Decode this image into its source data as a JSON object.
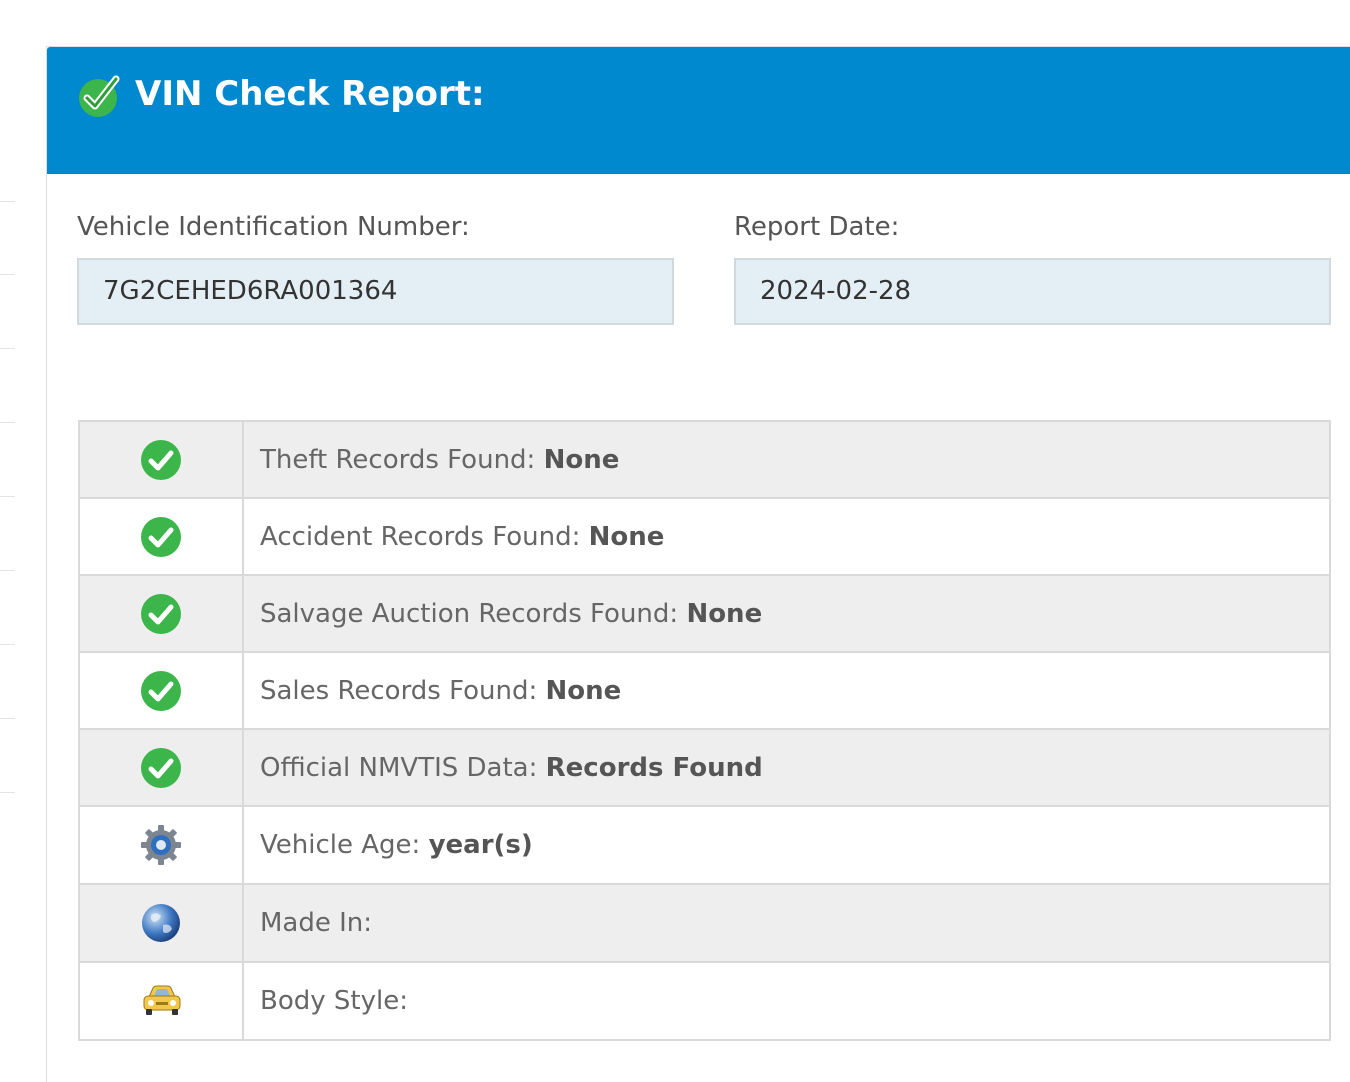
{
  "header": {
    "title": "VIN Check Report:",
    "icon": "check-circle-icon",
    "background": "#0089cf"
  },
  "fields": {
    "vin_label": "Vehicle Identification Number:",
    "vin_value": "7G2CEHED6RA001364",
    "date_label": "Report Date:",
    "date_value": "2024-02-28"
  },
  "records": [
    {
      "icon": "green-check-icon",
      "label": "Theft Records Found: ",
      "value": "None"
    },
    {
      "icon": "green-check-icon",
      "label": "Accident Records Found: ",
      "value": "None"
    },
    {
      "icon": "green-check-icon",
      "label": "Salvage Auction Records Found: ",
      "value": "None"
    },
    {
      "icon": "green-check-icon",
      "label": "Sales Records Found: ",
      "value": "None"
    },
    {
      "icon": "green-check-icon",
      "label": "Official NMVTIS Data: ",
      "value": "Records Found"
    },
    {
      "icon": "gear-icon",
      "label": "Vehicle Age: ",
      "value": "year(s)"
    },
    {
      "icon": "globe-icon",
      "label": "Made In:",
      "value": ""
    },
    {
      "icon": "car-icon",
      "label": "Body Style:",
      "value": ""
    }
  ],
  "colors": {
    "accent": "#0089cf",
    "check_green": "#3cb54a",
    "field_bg": "#e4eff5"
  }
}
